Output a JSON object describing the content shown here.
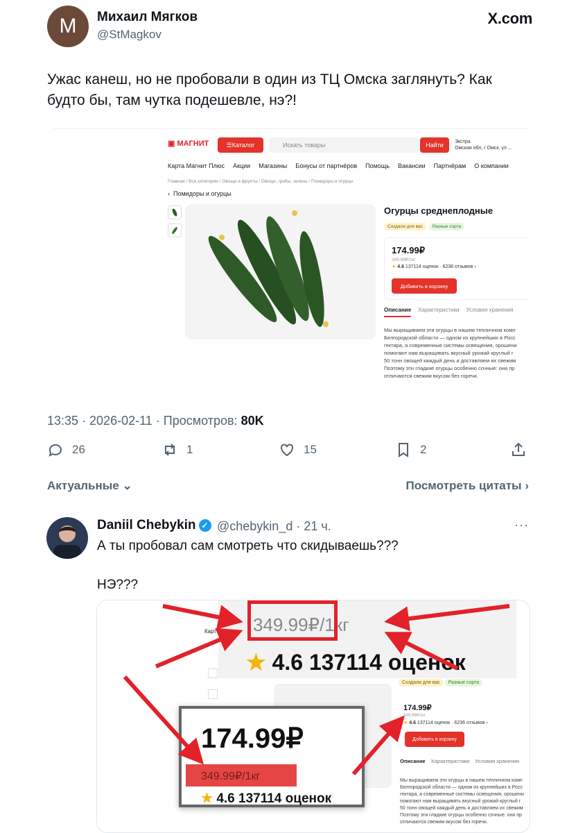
{
  "author": {
    "initial": "M",
    "name": "Михаил Мягков",
    "handle": "@StMagkov"
  },
  "brand": "X.com",
  "tweet_text": "Ужас канеш, но не пробовали в один из ТЦ Омска заглянуть? Как будто бы, там чутка подешевле, нэ?!",
  "magnit": {
    "logo": "МАГНИТ",
    "catalog": "Каталог",
    "search_placeholder": "Искать товары",
    "find": "Найти",
    "store_name": "Экстра",
    "store_addr": "Омская обл, г Омск, ул ...",
    "nav": [
      "Карта Магнит Плюс",
      "Акции",
      "Магазины",
      "Бонусы от партнёров",
      "Помощь",
      "Вакансии",
      "Партнёрам",
      "О компании"
    ],
    "breadcrumbs": "Главная / Все категории / Овощи и фрукты / Овощи, грибы, зелень / Помидоры и огурцы",
    "back": "Помидоры и огурцы",
    "product_title": "Огурцы среднеплодные",
    "tags": [
      "Создали для вас",
      "Разные сорта"
    ],
    "price": "174.99₽",
    "old_price": "349.99₽/1кг",
    "rating": "4.6",
    "rating_text": "137114 оценок · 6236 отзывов",
    "cart": "Добавить в корзину",
    "tabs": [
      "Описание",
      "Характеристики",
      "Условия хранения"
    ],
    "description": [
      "Мы выращиваем эти огурцы в нашем тепличном комп",
      "Белгородской области — одном из крупнейших в Росс",
      "гектара, а современные системы освещения, орошени",
      "помогают нам выращивать вкусный урожай круглый г",
      "50 тонн овощей каждый день и доставляем их свежим",
      "Поэтому эти гладкие огурцы особенно сочные: они пр",
      "отличаются свежим вкусом без горечи."
    ]
  },
  "meta": {
    "time": "13:35 · 2026-02-11 · Просмотров: ",
    "views": "80K"
  },
  "actions": {
    "replies": "26",
    "reposts": "1",
    "likes": "15",
    "bookmarks": "2"
  },
  "filter": "Актуальные",
  "quotes": "Посмотреть цитаты",
  "reply": {
    "name": "Daniil Chebykin",
    "handle": "@chebykin_d · 21 ч.",
    "text1": "А ты пробовал сам смотреть что скидываешь???",
    "text2": "НЭ???",
    "zoom_old": "349.99₽/1кг",
    "zoom_rate": "4.6  137114 оценок",
    "zoom_price": "174.99₽",
    "zoom_old2": "349.99₽/1кг",
    "zoom_rate2": "4.6  137114 оценок",
    "partial_word": "Карт"
  },
  "colors": {
    "brand_red": "#e3332a",
    "arrow_red": "#e3212a",
    "verified_blue": "#1d9bf0",
    "muted": "#536471"
  }
}
